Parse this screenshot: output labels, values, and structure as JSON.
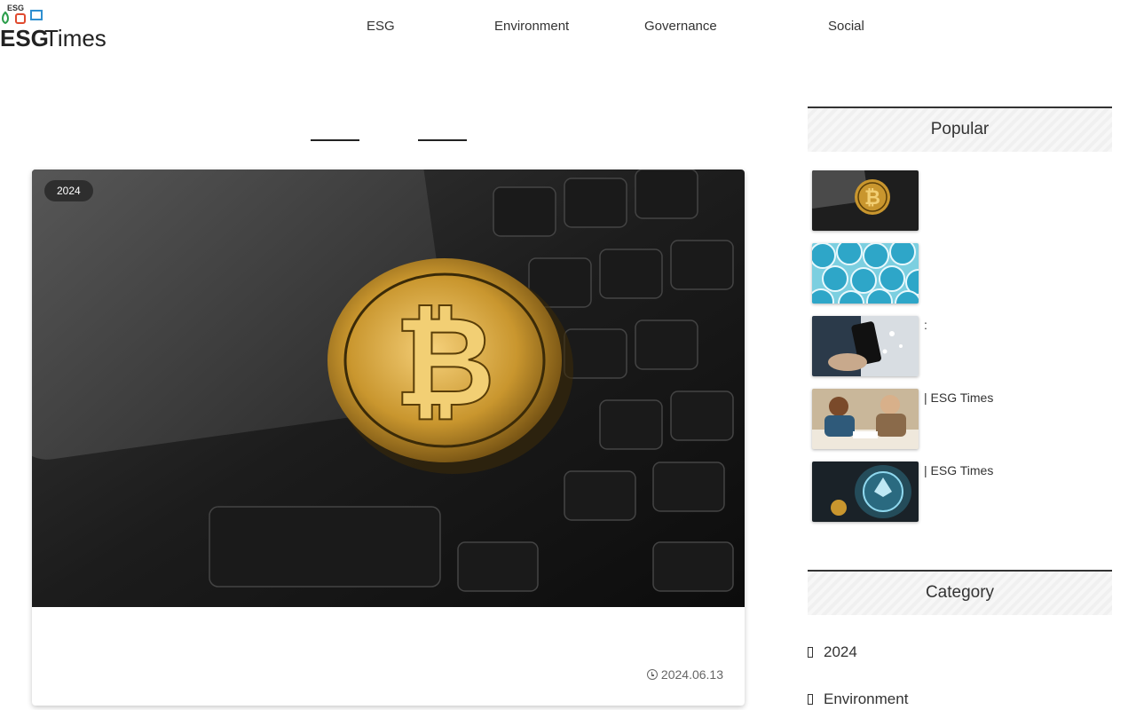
{
  "header": {
    "tagline": "ESG",
    "logo_text_primary": "ESG",
    "logo_text_secondary": "Times"
  },
  "nav": {
    "items": [
      {
        "label": "ESG"
      },
      {
        "label": "Environment"
      },
      {
        "label": "Governance"
      },
      {
        "label": "Social"
      }
    ]
  },
  "main": {
    "section_title": "",
    "featured": {
      "badge": "2024",
      "title": "",
      "excerpt": "",
      "date": "2024.06.13"
    }
  },
  "sidebar": {
    "popular": {
      "heading": "Popular",
      "items": [
        {
          "title": ""
        },
        {
          "title": ""
        },
        {
          "title": ": "
        },
        {
          "title": " | ESG Times"
        },
        {
          "title": " | ESG Times"
        }
      ]
    },
    "category": {
      "heading": "Category",
      "items": [
        {
          "label": "2024"
        },
        {
          "label": "Environment"
        }
      ]
    }
  },
  "colors": {
    "logo_green": "#2a9d4a",
    "logo_red": "#e04a2f",
    "logo_blue": "#2f8fd0",
    "coin_gold": "#d4a94a"
  }
}
